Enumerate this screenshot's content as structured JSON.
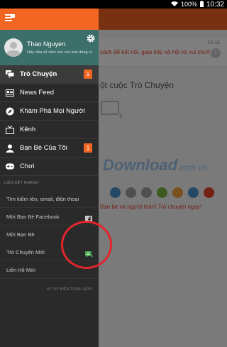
{
  "status_bar": {
    "battery": "100%",
    "time": "10:32"
  },
  "profile": {
    "name": "Thao  Nguyen",
    "status": "Hãy chia sẻ cảm xúc của bạn đang cảm..."
  },
  "menu": [
    {
      "label": "Trò Chuyện",
      "icon": "chat-icon",
      "count": "1",
      "active": true
    },
    {
      "label": "News Feed",
      "icon": "newsfeed-icon"
    },
    {
      "label": "Khám Phá Mọi Người",
      "icon": "compass-icon"
    },
    {
      "label": "Kênh",
      "icon": "channel-icon"
    },
    {
      "label": "Bạn Bè Của Tôi",
      "icon": "person-icon",
      "count": "1"
    },
    {
      "label": "Chơi",
      "icon": "gamepad-icon"
    }
  ],
  "quick_links": {
    "title": "LIÊN KẾT NHANH",
    "items": [
      {
        "label": "Tìm kiếm tên, email, điện thoại"
      },
      {
        "label": "Mời Bạn Bè Facebook",
        "icon": "facebook-icon"
      },
      {
        "label": "Mời Bạn Bè"
      },
      {
        "label": "Trò Chuyện Mới",
        "icon": "new-chat-icon"
      },
      {
        "label": "Liên Hệ Mới"
      }
    ]
  },
  "bottom_note": "TÙY BIẾN TRÌNH ĐƠN",
  "background": {
    "message_preview": "cách để kết nối, giao tiếp xã hội và vui chơi!",
    "message_time": "16:12",
    "message_count": "1",
    "heading": "ột cuộc Trò Chuyện",
    "watermark": "Download",
    "watermark_suffix": ".com.vn",
    "subtext": "Bạn bè và người thân! Trò chuyện ngay!",
    "dot_colors": [
      "#4a90c8",
      "#9e9e9e",
      "#9e9e9e",
      "#7cb342",
      "#f2a03d",
      "#4a90c8",
      "#e8452c"
    ]
  },
  "colors": {
    "accent": "#f26522",
    "profile_bg": "#3d6f6a",
    "drawer_bg": "#2a2a2a",
    "highlight": "#e0262c"
  }
}
